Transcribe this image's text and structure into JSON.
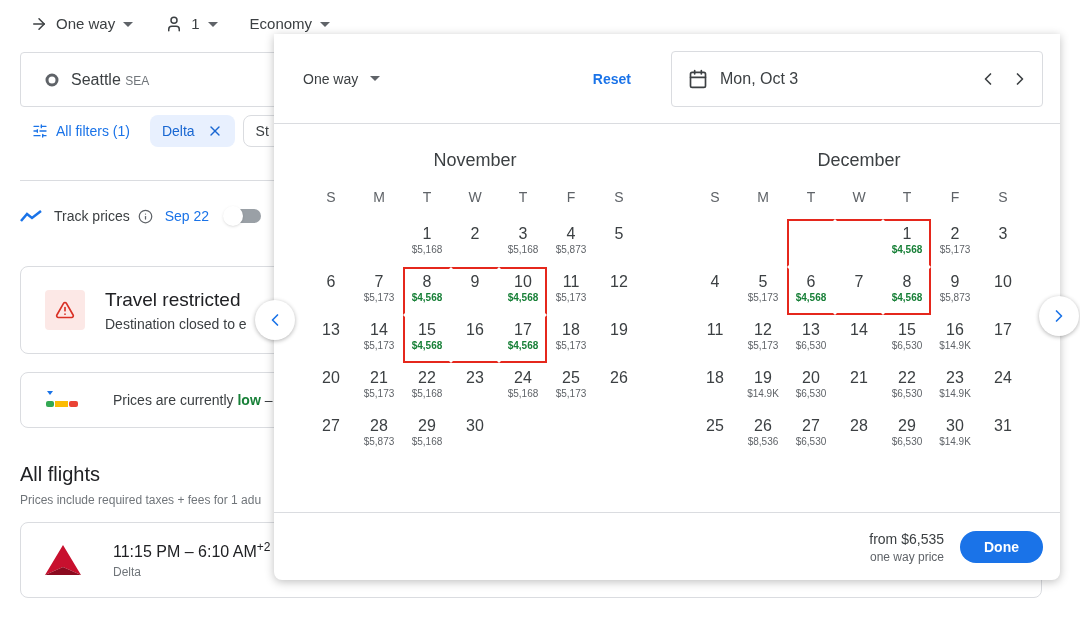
{
  "top_bar": [
    {
      "kind": "trip",
      "label": "One way"
    },
    {
      "kind": "passengers",
      "label": "1"
    },
    {
      "kind": "cabin",
      "label": "Economy"
    }
  ],
  "origin": {
    "city": "Seattle",
    "code": "SEA"
  },
  "filters": {
    "all": "All filters (1)",
    "chip": "Delta",
    "next_chip": "St"
  },
  "track": {
    "label": "Track prices",
    "date": "Sep 22",
    "on": false
  },
  "alert": {
    "title": "Travel restricted",
    "text": "Destination closed to e"
  },
  "price_insight": {
    "text": "Prices are currently **low** –"
  },
  "flights": {
    "title": "All flights",
    "note": "Prices include required taxes + fees for 1 adu",
    "items": [
      {
        "time": "11:15 PM – 6:10 AM$^{+2}$",
        "airline": "Delta"
      }
    ]
  },
  "popup": {
    "trip_type": "One way",
    "reset": "Reset",
    "date": "Mon, Oct 3",
    "months": [
      {
        "name": "November",
        "weekdays": [
          "S",
          "M",
          "T",
          "W",
          "T",
          "F",
          "S"
        ],
        "weeks": [
          [
            {
              "kind": "empty"
            },
            {
              "kind": "empty"
            },
            {
              "kind": "day",
              "day": "1",
              "price": "$5,168",
              "cheap": false,
              "marked": false
            },
            {
              "kind": "day",
              "day": "2",
              "marked": false
            },
            {
              "kind": "day",
              "day": "3",
              "price": "$5,168",
              "cheap": false,
              "marked": false
            },
            {
              "kind": "day",
              "day": "4",
              "price": "$5,873",
              "cheap": false,
              "marked": false
            },
            {
              "kind": "day",
              "day": "5",
              "marked": false
            }
          ],
          [
            {
              "kind": "day",
              "day": "6",
              "marked": false
            },
            {
              "kind": "day",
              "day": "7",
              "price": "$5,173",
              "cheap": false,
              "marked": false
            },
            {
              "kind": "day",
              "day": "8",
              "price": "$4,568",
              "cheap": true,
              "marked": true
            },
            {
              "kind": "day",
              "day": "9",
              "marked": true
            },
            {
              "kind": "day",
              "day": "10",
              "price": "$4,568",
              "cheap": true,
              "marked": true
            },
            {
              "kind": "day",
              "day": "11",
              "price": "$5,173",
              "cheap": false,
              "marked": false
            },
            {
              "kind": "day",
              "day": "12",
              "marked": false
            }
          ],
          [
            {
              "kind": "day",
              "day": "13",
              "marked": false
            },
            {
              "kind": "day",
              "day": "14",
              "price": "$5,173",
              "cheap": false,
              "marked": false
            },
            {
              "kind": "day",
              "day": "15",
              "price": "$4,568",
              "cheap": true,
              "marked": true
            },
            {
              "kind": "day",
              "day": "16",
              "marked": true
            },
            {
              "kind": "day",
              "day": "17",
              "price": "$4,568",
              "cheap": true,
              "marked": true
            },
            {
              "kind": "day",
              "day": "18",
              "price": "$5,173",
              "cheap": false,
              "marked": false
            },
            {
              "kind": "day",
              "day": "19",
              "marked": false
            }
          ],
          [
            {
              "kind": "day",
              "day": "20",
              "marked": false
            },
            {
              "kind": "day",
              "day": "21",
              "price": "$5,173",
              "cheap": false,
              "marked": false
            },
            {
              "kind": "day",
              "day": "22",
              "price": "$5,168",
              "cheap": false,
              "marked": false
            },
            {
              "kind": "day",
              "day": "23",
              "marked": false
            },
            {
              "kind": "day",
              "day": "24",
              "price": "$5,168",
              "cheap": false,
              "marked": false
            },
            {
              "kind": "day",
              "day": "25",
              "price": "$5,173",
              "cheap": false,
              "marked": false
            },
            {
              "kind": "day",
              "day": "26",
              "marked": false
            }
          ],
          [
            {
              "kind": "day",
              "day": "27",
              "marked": false
            },
            {
              "kind": "day",
              "day": "28",
              "price": "$5,873",
              "cheap": false,
              "marked": false
            },
            {
              "kind": "day",
              "day": "29",
              "price": "$5,168",
              "cheap": false,
              "marked": false
            },
            {
              "kind": "day",
              "day": "30",
              "marked": false
            }
          ]
        ]
      },
      {
        "name": "December",
        "weekdays": [
          "S",
          "M",
          "T",
          "W",
          "T",
          "F",
          "S"
        ],
        "weeks": [
          [
            {
              "kind": "empty"
            },
            {
              "kind": "empty"
            },
            {
              "kind": "empty",
              "marked": true
            },
            {
              "kind": "empty",
              "marked": true
            },
            {
              "kind": "day",
              "day": "1",
              "price": "$4,568",
              "cheap": true,
              "marked": true
            },
            {
              "kind": "day",
              "day": "2",
              "price": "$5,173",
              "cheap": false,
              "marked": false
            },
            {
              "kind": "day",
              "day": "3",
              "marked": false
            }
          ],
          [
            {
              "kind": "day",
              "day": "4",
              "marked": false
            },
            {
              "kind": "day",
              "day": "5",
              "price": "$5,173",
              "cheap": false,
              "marked": false
            },
            {
              "kind": "day",
              "day": "6",
              "price": "$4,568",
              "cheap": true,
              "marked": true
            },
            {
              "kind": "day",
              "day": "7",
              "marked": true
            },
            {
              "kind": "day",
              "day": "8",
              "price": "$4,568",
              "cheap": true,
              "marked": true
            },
            {
              "kind": "day",
              "day": "9",
              "price": "$5,873",
              "cheap": false,
              "marked": false
            },
            {
              "kind": "day",
              "day": "10",
              "marked": false
            }
          ],
          [
            {
              "kind": "day",
              "day": "11",
              "marked": false
            },
            {
              "kind": "day",
              "day": "12",
              "price": "$5,173",
              "cheap": false,
              "marked": false
            },
            {
              "kind": "day",
              "day": "13",
              "price": "$6,530",
              "cheap": false,
              "marked": false
            },
            {
              "kind": "day",
              "day": "14",
              "marked": false
            },
            {
              "kind": "day",
              "day": "15",
              "price": "$6,530",
              "cheap": false,
              "marked": false
            },
            {
              "kind": "day",
              "day": "16",
              "price": "$14.9K",
              "cheap": false,
              "marked": false
            },
            {
              "kind": "day",
              "day": "17",
              "marked": false
            }
          ],
          [
            {
              "kind": "day",
              "day": "18",
              "marked": false
            },
            {
              "kind": "day",
              "day": "19",
              "price": "$14.9K",
              "cheap": false,
              "marked": false
            },
            {
              "kind": "day",
              "day": "20",
              "price": "$6,530",
              "cheap": false,
              "marked": false
            },
            {
              "kind": "day",
              "day": "21",
              "marked": false
            },
            {
              "kind": "day",
              "day": "22",
              "price": "$6,530",
              "cheap": false,
              "marked": false
            },
            {
              "kind": "day",
              "day": "23",
              "price": "$14.9K",
              "cheap": false,
              "marked": false
            },
            {
              "kind": "day",
              "day": "24",
              "marked": false
            }
          ],
          [
            {
              "kind": "day",
              "day": "25",
              "marked": false
            },
            {
              "kind": "day",
              "day": "26",
              "price": "$8,536",
              "cheap": false,
              "marked": false
            },
            {
              "kind": "day",
              "day": "27",
              "price": "$6,530",
              "cheap": false,
              "marked": false
            },
            {
              "kind": "day",
              "day": "28",
              "marked": false
            },
            {
              "kind": "day",
              "day": "29",
              "price": "$6,530",
              "cheap": false,
              "marked": false
            },
            {
              "kind": "day",
              "day": "30",
              "price": "$14.9K",
              "cheap": false,
              "marked": false
            },
            {
              "kind": "day",
              "day": "31",
              "marked": false
            }
          ]
        ]
      }
    ],
    "footer": {
      "price": "from $6,535",
      "note": "one way price",
      "done": "Done"
    }
  }
}
